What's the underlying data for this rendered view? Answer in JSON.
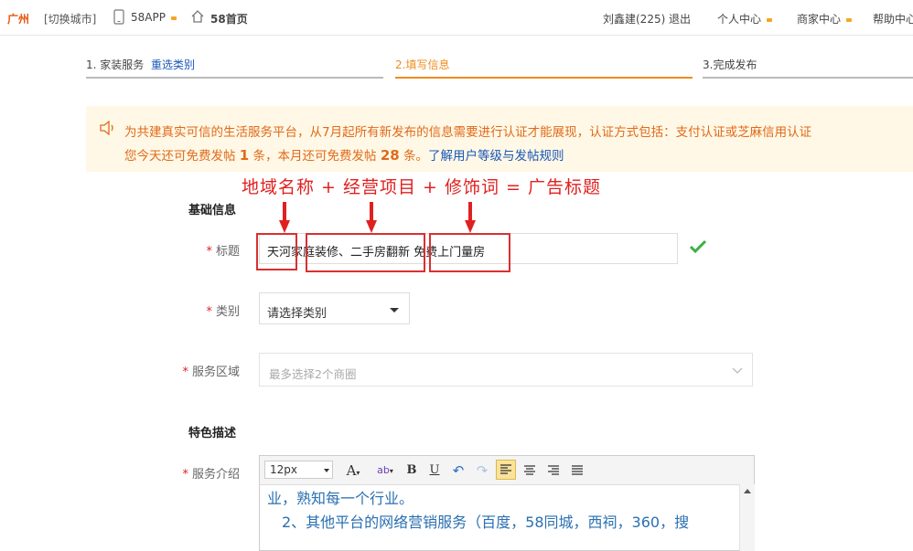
{
  "topbar": {
    "city": "广州",
    "switch_city": "[切换城市]",
    "app_label": "58APP",
    "home_label": "58首页",
    "user": "刘鑫建(225)",
    "logout": "退出",
    "personal_center": "个人中心",
    "merchant_center": "商家中心",
    "help_center": "帮助中心"
  },
  "steps": {
    "step1": "1. 家装服务",
    "reselect": "重选类别",
    "step2": "2.填写信息",
    "step3": "3.完成发布"
  },
  "notice": {
    "line1": "为共建真实可信的生活服务平台，从7月起所有新发布的信息需要进行认证才能展现，认证方式包括：支付认证或芝麻信用认证",
    "line2_prefix": "您今天还可免费发帖",
    "today_count": "1",
    "line2_mid": "条，本月还可免费发帖",
    "month_count": "28",
    "line2_suffix": "条。",
    "link": "了解用户等级与发帖规则"
  },
  "annotation": {
    "formula": "地域名称 + 经营项目 + 修饰词 = 广告标题"
  },
  "form": {
    "basic_section": "基础信息",
    "title_label": "标题",
    "title_value": "天河家庭装修、二手房翻新 免费上门量房",
    "category_label": "类别",
    "category_value": "请选择类别",
    "area_label": "服务区域",
    "area_placeholder": "最多选择2个商圈",
    "feature_section": "特色描述",
    "intro_label": "服务介绍",
    "required_mark": "*"
  },
  "editor": {
    "font_size": "12px",
    "line1": "业，熟知每一个行业。",
    "line2": "2、其他平台的网络营销服务（百度，58同城，西祠，360，搜"
  },
  "colors": {
    "brand_orange": "#e8570e",
    "active_step": "#f08c1e",
    "link_blue": "#1a57b8",
    "annotation_red": "#e02020",
    "check_green": "#3cb043"
  }
}
